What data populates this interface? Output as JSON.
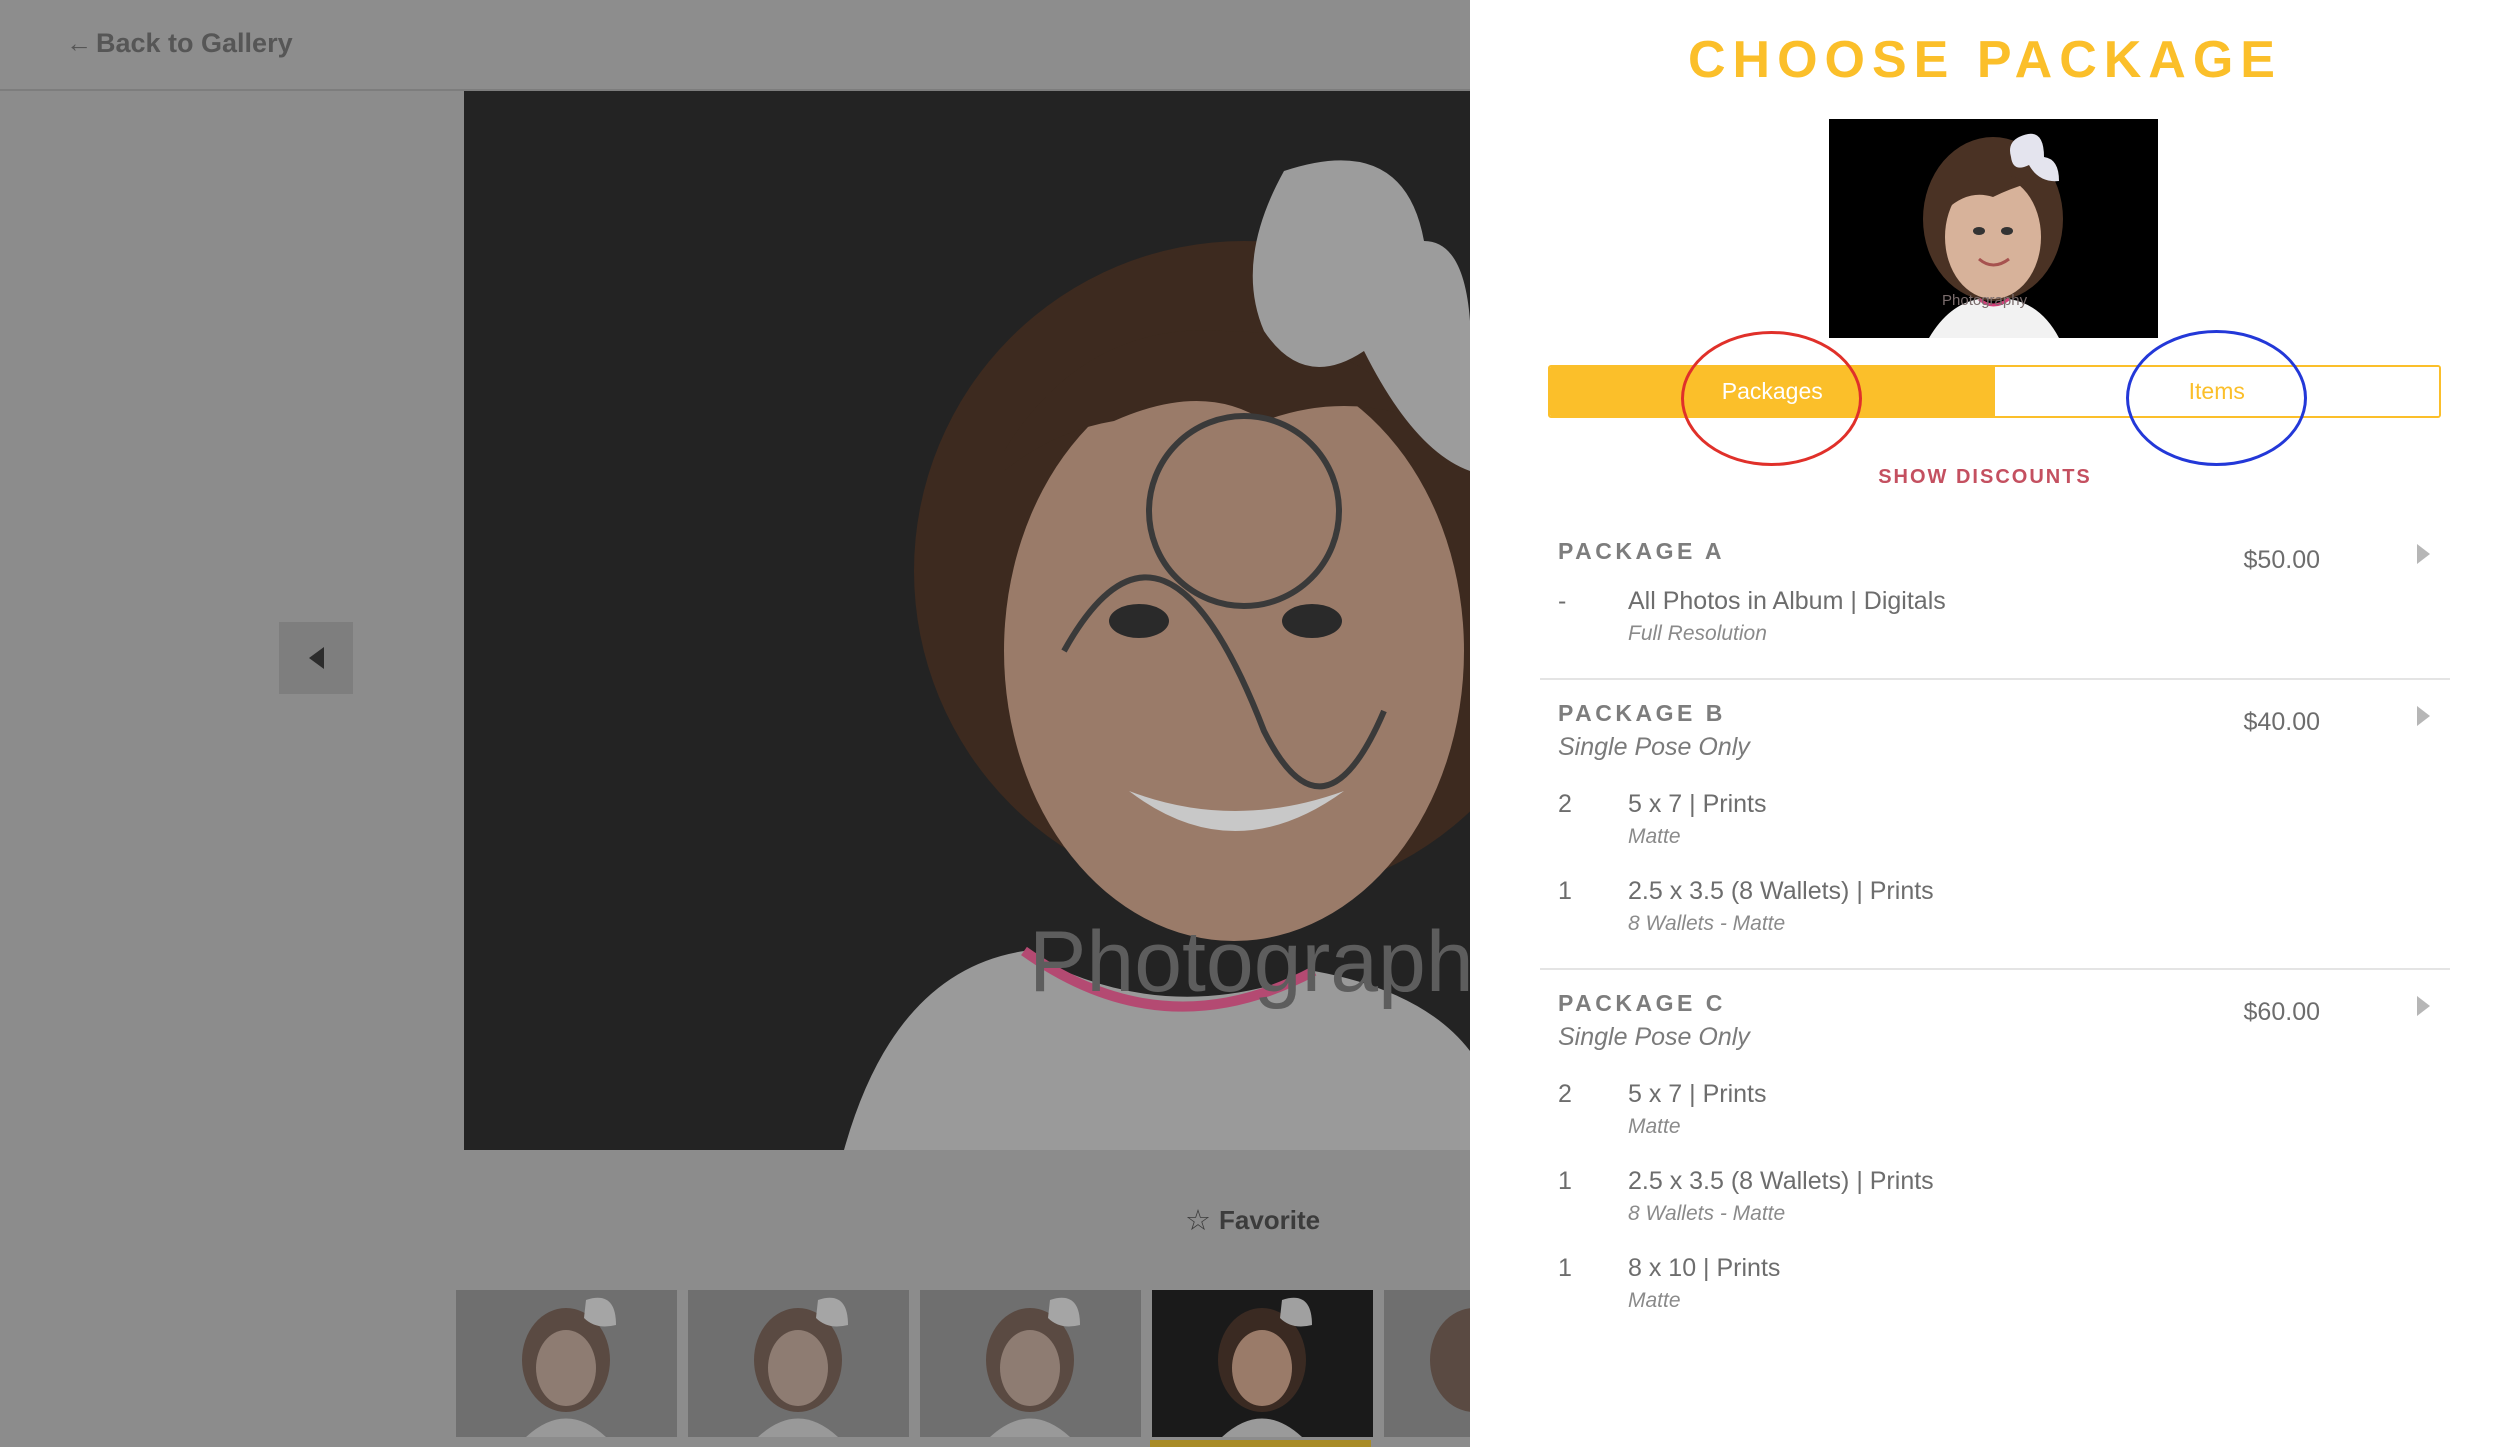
{
  "header": {
    "back_label": "Back to Gallery",
    "back_arrow": "←"
  },
  "viewer": {
    "favorite_label": "Favorite",
    "star_glyph": "☆",
    "watermark": "Photography"
  },
  "panel": {
    "title": "CHOOSE PACKAGE",
    "preview_watermark": "Photography",
    "tabs": [
      {
        "label": "Packages",
        "active": true
      },
      {
        "label": "Items",
        "active": false
      }
    ],
    "discounts_label": "SHOW DISCOUNTS",
    "packages": [
      {
        "name": "PACKAGE A",
        "subtitle": "",
        "price": "$50.00",
        "items": [
          {
            "qty": "-",
            "desc": "All Photos in Album | Digitals",
            "note": "Full Resolution"
          }
        ]
      },
      {
        "name": "PACKAGE B",
        "subtitle": "Single Pose Only",
        "price": "$40.00",
        "items": [
          {
            "qty": "2",
            "desc": "5 x 7 | Prints",
            "note": "Matte"
          },
          {
            "qty": "1",
            "desc": "2.5 x 3.5 (8 Wallets) | Prints",
            "note": "8 Wallets - Matte"
          }
        ]
      },
      {
        "name": "PACKAGE C",
        "subtitle": "Single Pose Only",
        "price": "$60.00",
        "items": [
          {
            "qty": "2",
            "desc": "5 x 7 | Prints",
            "note": "Matte"
          },
          {
            "qty": "1",
            "desc": "2.5 x 3.5 (8 Wallets) | Prints",
            "note": "8 Wallets - Matte"
          },
          {
            "qty": "1",
            "desc": "8 x 10 | Prints",
            "note": "Matte"
          }
        ]
      }
    ]
  },
  "colors": {
    "accent": "#fbbf2a",
    "discount": "#c45060",
    "annotation_red": "#e0302a",
    "annotation_blue": "#2338d8"
  },
  "icons": {
    "back": "arrow-left-icon",
    "prev": "caret-left-icon",
    "favorite": "star-outline-icon",
    "package_arrow": "caret-right-icon"
  }
}
